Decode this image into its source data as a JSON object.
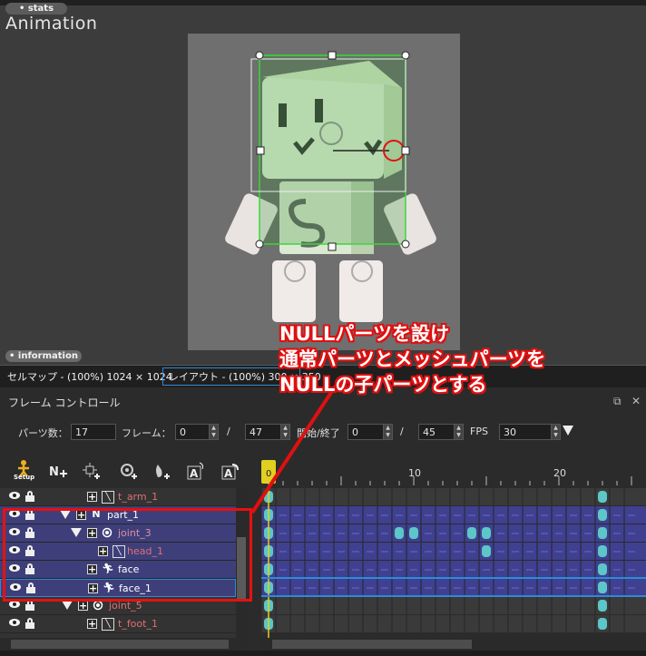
{
  "viewport": {
    "stats_label": "• stats",
    "title": "Animation",
    "info_label": "• information"
  },
  "tabs": [
    {
      "label": "セルマップ - (100%) 1024 × 1024"
    },
    {
      "label": "レイアウト - (100%) 300 × 350"
    }
  ],
  "frame_control": {
    "title": "フレーム コントロール",
    "parts_count_label": "パーツ数：",
    "parts_count": "17",
    "frame_label": "フレーム：",
    "frame_value": "0",
    "frame_total": "47",
    "start_end_label": "開始/終了",
    "start_value": "0",
    "end_value": "45",
    "slash": "/",
    "fps_label": "FPS",
    "fps_value": "30"
  },
  "toolbar": {
    "setup_label": "Setup",
    "icons": [
      "setup-icon",
      "add-null-part-icon",
      "add-normal-part-icon",
      "add-joint-icon",
      "add-bone-icon",
      "add-text-a-icon",
      "rotate-text-a-icon"
    ]
  },
  "layers": [
    {
      "name": "t_arm_1",
      "indent": 0,
      "type": "normal",
      "selected": false,
      "color": "#e07070"
    },
    {
      "name": "part_1",
      "indent": 0,
      "type": "null",
      "selected": true,
      "color": "#ffffff",
      "expanded": true
    },
    {
      "name": "joint_3",
      "indent": 1,
      "type": "joint",
      "selected": true,
      "color": "#e090a0",
      "expanded": true
    },
    {
      "name": "head_1",
      "indent": 2,
      "type": "normal",
      "selected": true,
      "color": "#e07070"
    },
    {
      "name": "face",
      "indent": 1,
      "type": "mesh",
      "selected": true,
      "color": "#ffffff"
    },
    {
      "name": "face_1",
      "indent": 1,
      "type": "mesh",
      "selected": true,
      "color": "#ffffff"
    },
    {
      "name": "joint_5",
      "indent": 0,
      "type": "joint",
      "selected": false,
      "color": "#e07070",
      "expanded": true
    },
    {
      "name": "t_foot_1",
      "indent": 1,
      "type": "normal",
      "selected": false,
      "color": "#e07070"
    }
  ],
  "timeline": {
    "tick_labels": [
      "0",
      "10",
      "20"
    ],
    "current_frame": "0",
    "keyframes": [
      [
        0,
        23
      ],
      [
        0,
        23
      ],
      [
        0,
        9,
        10,
        14,
        15,
        23
      ],
      [
        0,
        15,
        23
      ],
      [
        0,
        23
      ],
      [
        0,
        23
      ],
      [
        0,
        23
      ],
      [
        0,
        23
      ]
    ]
  },
  "annotation": {
    "lines": [
      "NULLパーツを設け",
      "通常パーツとメッシュパーツを",
      "NULLの子パーツとする"
    ],
    "color": "#e01010"
  },
  "colors": {
    "accent_blue": "#2e8ad8",
    "selection": "#3e3f7a",
    "keyframe": "#5cc6c8",
    "playhead": "#e0d020"
  }
}
